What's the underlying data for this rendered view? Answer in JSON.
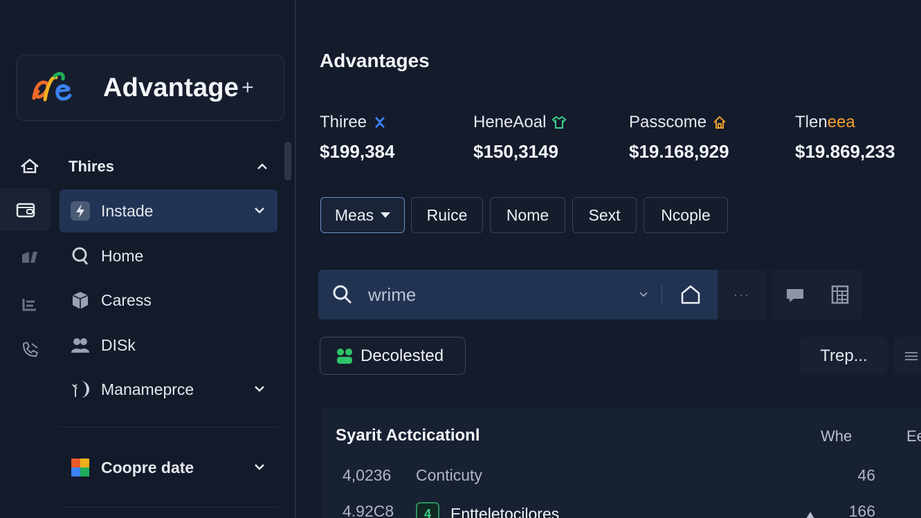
{
  "brand": {
    "name": "Advantage",
    "plus": "+"
  },
  "sidebar": {
    "section_1": "Thires",
    "items": [
      {
        "label": "Instade",
        "icon": "bolt-icon",
        "active": true,
        "expandable": true
      },
      {
        "label": "Home",
        "icon": "search-person-icon"
      },
      {
        "label": "Caress",
        "icon": "box-icon"
      },
      {
        "label": "DISk",
        "icon": "users-icon"
      },
      {
        "label": "Manameprce",
        "icon": "leaf-moon-icon",
        "expandable": true
      }
    ],
    "section_2": "Coopre date",
    "rail": [
      "home-icon",
      "wallet-icon",
      "chart-icon",
      "list-icon",
      "phone-icon"
    ]
  },
  "main": {
    "title": "Advantages",
    "stats": [
      {
        "label": "Thiree",
        "value": "$199,384",
        "icon": "sparkle-icon",
        "color": "#3b7ff0"
      },
      {
        "label": "HeneAoal",
        "value": "$150,3149",
        "icon": "shirt-icon",
        "color": "#3ed08a"
      },
      {
        "label": "Passcome",
        "value": "$19.168,929",
        "icon": "house-icon",
        "color": "#f0a030"
      },
      {
        "label_a": "Tlen",
        "label_b": "eea",
        "value": "$19.869,233",
        "color": "#f0a030"
      }
    ],
    "filters": [
      "Meas",
      "Ruice",
      "Nome",
      "Sext",
      "Ncople"
    ],
    "search": {
      "value": "wrime",
      "more": "···"
    },
    "status_button": "Decolested",
    "trep_button": "Trep...",
    "table": {
      "title": "Syarit Actcicationl",
      "columns": [
        "Whe",
        "Ee"
      ],
      "rows": [
        {
          "id": "4,0236",
          "name": "Conticuty",
          "value": "46"
        },
        {
          "id": "4.92C8",
          "name": "Entteletocilores",
          "value": "166",
          "icon_text": "4"
        }
      ]
    }
  }
}
